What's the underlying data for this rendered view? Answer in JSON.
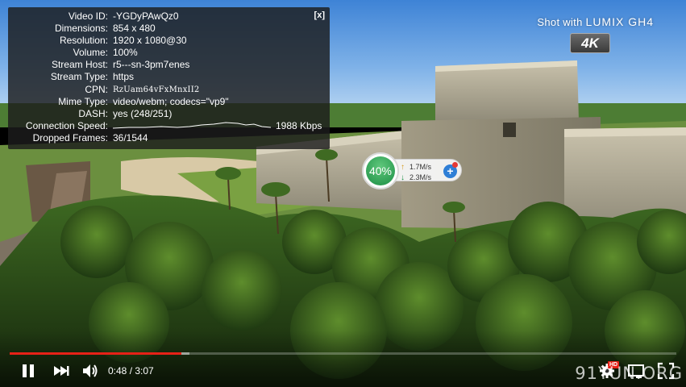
{
  "stats": {
    "close_label": "[x]",
    "rows": [
      {
        "label": "Video ID:",
        "value": "-YGDyPAwQz0"
      },
      {
        "label": "Dimensions:",
        "value": "854 x 480"
      },
      {
        "label": "Resolution:",
        "value": "1920 x 1080@30"
      },
      {
        "label": "Volume:",
        "value": "100%"
      },
      {
        "label": "Stream Host:",
        "value": "r5---sn-3pm7enes"
      },
      {
        "label": "Stream Type:",
        "value": "https"
      },
      {
        "label": "CPN:",
        "value": "RzUam64vFxMnxII2"
      },
      {
        "label": "Mime Type:",
        "value": "video/webm; codecs=\"vp9\""
      },
      {
        "label": "DASH:",
        "value": "yes (248/251)"
      }
    ],
    "connection_speed": {
      "label": "Connection Speed:",
      "value": "1988 Kbps"
    },
    "dropped_frames": {
      "label": "Dropped Frames:",
      "value": "36/1544"
    }
  },
  "branding": {
    "shot_with": "Shot with",
    "brand": "LUMIX GH4",
    "badge": "4K"
  },
  "speed_widget": {
    "percent": "40%",
    "upload": "1.7M/s",
    "download": "2.3M/s",
    "up_arrow": "↑",
    "down_arrow": "↓",
    "plus": "+"
  },
  "player": {
    "current_time": "0:48",
    "duration": "3:07",
    "time_text": "0:48 / 3:07",
    "played_fraction": 0.257,
    "buffered_fraction": 0.27,
    "hd_badge": "HD",
    "progress_color": "#e62117"
  },
  "watermark": "91YUN.ORG",
  "icons": [
    "pause-icon",
    "next-icon",
    "volume-icon",
    "settings-icon",
    "miniplayer-icon",
    "fullscreen-icon"
  ]
}
